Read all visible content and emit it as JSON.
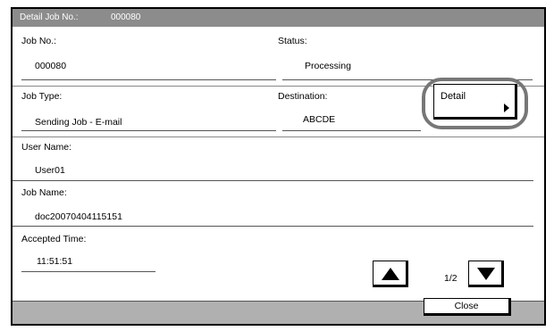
{
  "title_bar": {
    "label": "Detail Job No.:",
    "value": "000080"
  },
  "fields": {
    "job_no": {
      "label": "Job No.:",
      "value": "000080"
    },
    "status": {
      "label": "Status:",
      "value": "Processing"
    },
    "job_type": {
      "label": "Job Type:",
      "value": "Sending Job - E-mail"
    },
    "destination": {
      "label": "Destination:",
      "value": "ABCDE"
    },
    "user_name": {
      "label": "User Name:",
      "value": "User01"
    },
    "job_name": {
      "label": "Job Name:",
      "value": "doc20070404115151"
    },
    "accepted_time": {
      "label": "Accepted Time:",
      "value": "11:51:51"
    }
  },
  "detail_button": {
    "label": "Detail",
    "icon": "triangle-right-icon"
  },
  "pagination": {
    "page": "1/2",
    "up_icon": "triangle-up-icon",
    "down_icon": "triangle-down-icon"
  },
  "footer": {
    "close_label": "Close"
  },
  "colors": {
    "title_bar": "#8c8c8c",
    "footer": "#b0b0b0",
    "highlight_ring": "#777777"
  }
}
